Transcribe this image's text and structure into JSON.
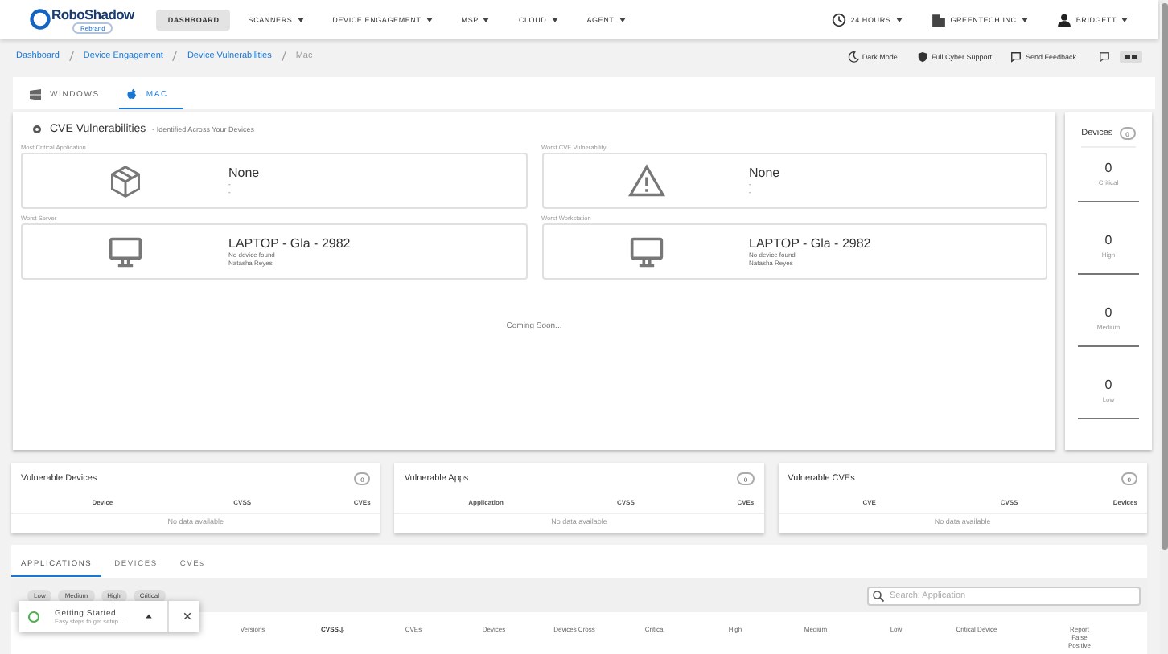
{
  "nav": {
    "brand": "RoboShadow",
    "brand_badge": "Rebrand",
    "time_range": "24 HOURS",
    "company": "GREENTECH INC",
    "user": "BRIDGETT",
    "items": [
      {
        "label": "DASHBOARD",
        "selected": true,
        "has_menu": false
      },
      {
        "label": "SCANNERS",
        "selected": false,
        "has_menu": true
      },
      {
        "label": "DEVICE ENGAGEMENT",
        "selected": false,
        "has_menu": true
      },
      {
        "label": "MSP",
        "selected": false,
        "has_menu": true
      },
      {
        "label": "CLOUD",
        "selected": false,
        "has_menu": true
      },
      {
        "label": "AGENT",
        "selected": false,
        "has_menu": true
      }
    ]
  },
  "breadcrumbs": [
    "Dashboard",
    "Device Engagement",
    "Device Vulnerabilities",
    "Mac"
  ],
  "actions": [
    {
      "label": "Dark Mode",
      "kind": "moon"
    },
    {
      "label": "Full Cyber Support",
      "kind": "shield"
    },
    {
      "label": "Send Feedback",
      "kind": "chat"
    }
  ],
  "os_tabs": [
    {
      "label": "WINDOWS",
      "kind": "windows",
      "selected": false
    },
    {
      "label": "MAC",
      "kind": "apple",
      "selected": true
    }
  ],
  "overview": {
    "title": "CVE Vulnerabilities",
    "subtitle": "- Identified Across Your Devices",
    "note": "Coming Soon...",
    "cards": [
      {
        "label": "Most Critical Application",
        "kind": "package",
        "name": "None",
        "lines": [
          "-",
          "-"
        ]
      },
      {
        "label": "Worst CVE Vulnerability",
        "kind": "warning",
        "name": "None",
        "lines": [
          "-",
          "-"
        ]
      },
      {
        "label": "Worst Server",
        "kind": "monitor",
        "name": "LAPTOP - Gla - 2982",
        "lines": [
          "No device found",
          "Natasha Reyes"
        ]
      },
      {
        "label": "Worst Workstation",
        "kind": "monitor",
        "name": "LAPTOP - Gla - 2982",
        "lines": [
          "No device found",
          "Natasha Reyes"
        ]
      }
    ]
  },
  "devices": {
    "title": "Devices",
    "count": "0",
    "stats": [
      {
        "value": "0",
        "label": "Critical"
      },
      {
        "value": "0",
        "label": "High"
      },
      {
        "value": "0",
        "label": "Medium"
      },
      {
        "value": "0",
        "label": "Low"
      }
    ]
  },
  "lists": [
    {
      "title": "Vulnerable Devices",
      "count": "0",
      "columns": [
        "Device",
        "CVSS",
        "CVEs"
      ],
      "empty": "No data available"
    },
    {
      "title": "Vulnerable Apps",
      "count": "0",
      "columns": [
        "Application",
        "CVSS",
        "CVEs"
      ],
      "empty": "No data available"
    },
    {
      "title": "Vulnerable CVEs",
      "count": "0",
      "columns": [
        "CVE",
        "CVSS",
        "Devices"
      ],
      "empty": "No data available"
    }
  ],
  "detail_tabs": [
    {
      "label": "APPLICATIONS",
      "selected": true
    },
    {
      "label": "DEVICES",
      "selected": false
    },
    {
      "label": "CVEs",
      "selected": false
    }
  ],
  "filters": [
    "Low",
    "Medium",
    "High",
    "Critical"
  ],
  "search": {
    "placeholder": "Search: Application"
  },
  "columns": [
    {
      "label": "Versions",
      "sorted": false
    },
    {
      "label": "CVSS",
      "sorted": true
    },
    {
      "label": "CVEs",
      "sorted": false
    },
    {
      "label": "Devices",
      "sorted": false
    },
    {
      "label": "Devices Cross",
      "sorted": false
    },
    {
      "label": "Critical",
      "sorted": false
    },
    {
      "label": "High",
      "sorted": false
    },
    {
      "label": "Medium",
      "sorted": false
    },
    {
      "label": "Low",
      "sorted": false
    },
    {
      "label": "Critical Device",
      "sorted": false
    },
    {
      "label": "Report False Positive",
      "sorted": false
    }
  ],
  "toast": {
    "title": "Getting Started",
    "subtitle": "Easy steps to get setup..."
  }
}
